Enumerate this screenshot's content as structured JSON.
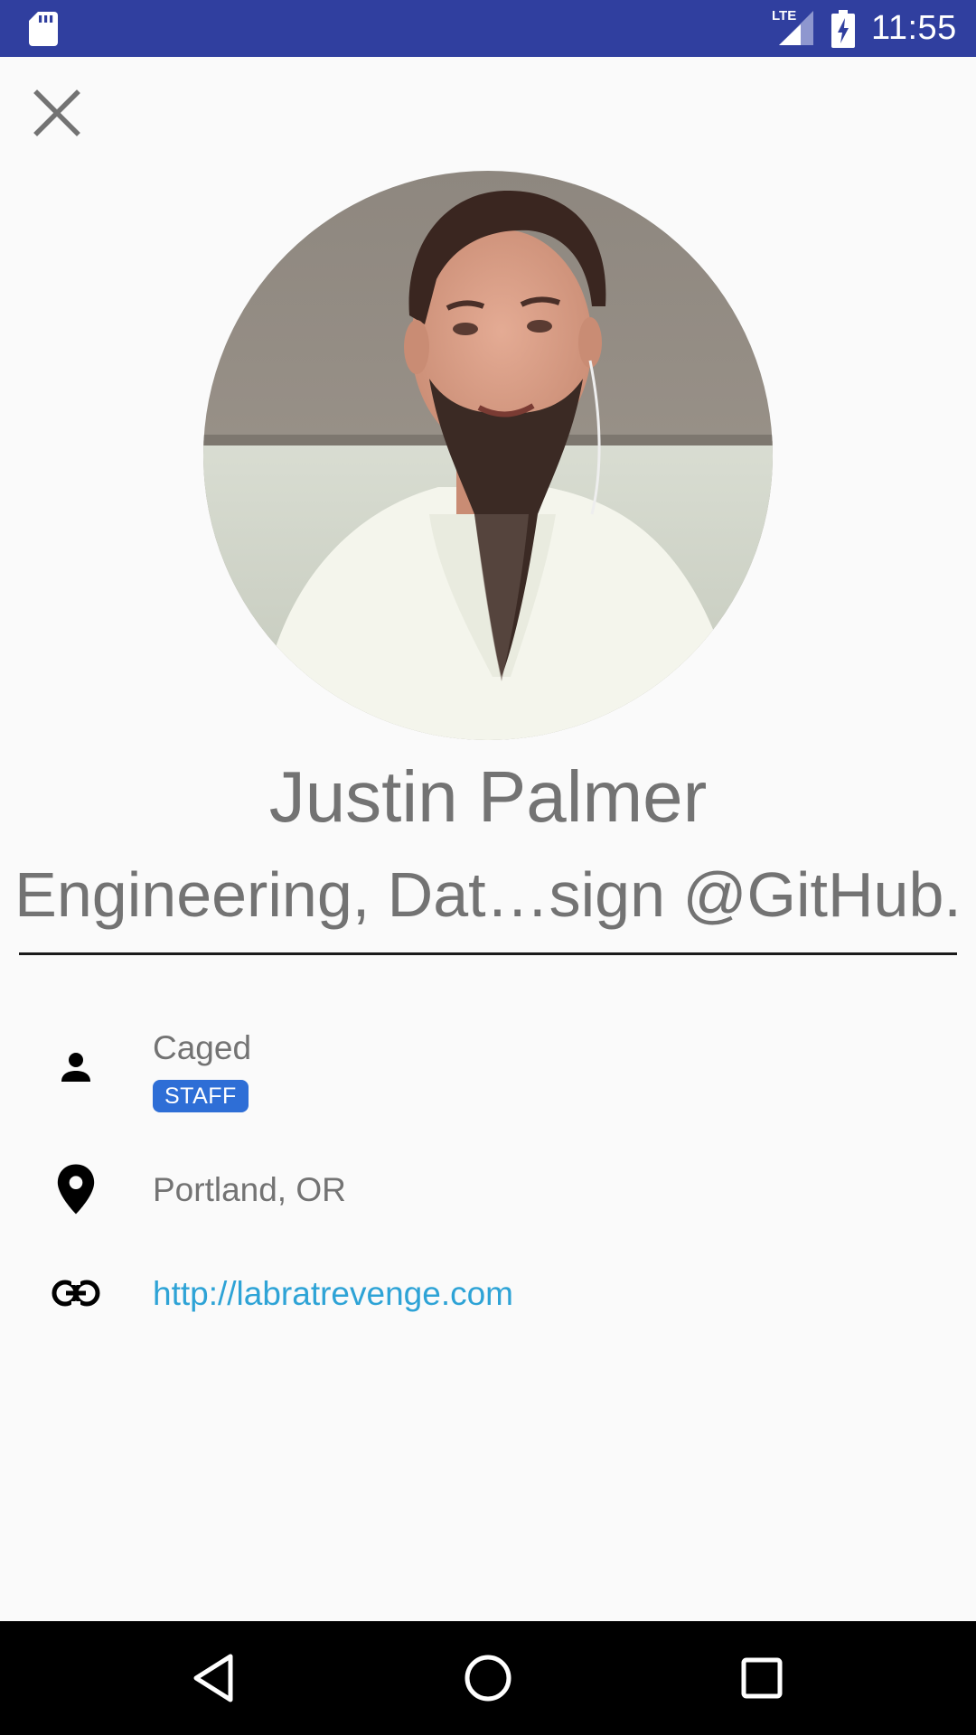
{
  "status_bar": {
    "time": "11:55",
    "network_label": "LTE",
    "left_icon": "sd-card-icon",
    "battery_icon": "battery-charging-icon",
    "signal_icon": "signal-icon"
  },
  "header": {
    "close_icon": "close-icon"
  },
  "profile": {
    "avatar_icon": "avatar-photo",
    "name": "Justin Palmer",
    "bio": "Engineering, Dat…sign @GitHub."
  },
  "details": {
    "company": {
      "icon": "person-icon",
      "text": "Caged",
      "badge": "STAFF"
    },
    "location": {
      "icon": "location-pin-icon",
      "text": "Portland, OR"
    },
    "website": {
      "icon": "link-icon",
      "text": "http://labratrevenge.com"
    }
  },
  "nav_bar": {
    "back_icon": "back-icon",
    "home_icon": "home-icon",
    "recents_icon": "recents-icon"
  },
  "colors": {
    "status_bar": "#303f9f",
    "background": "#fafafa",
    "text_secondary": "#737373",
    "link": "#2ea3d6",
    "badge": "#2e6ed6",
    "nav_bar": "#000000"
  }
}
